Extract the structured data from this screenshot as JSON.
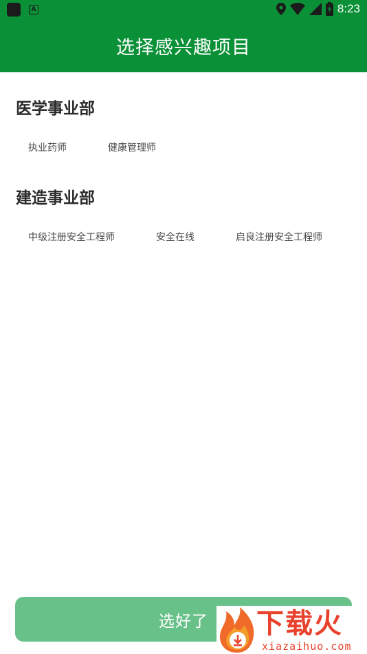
{
  "status_bar": {
    "time": "8:23",
    "icons": [
      "app-icon",
      "a-notification-icon",
      "location-icon",
      "wifi-icon",
      "signal-icon",
      "battery-icon"
    ]
  },
  "header": {
    "title": "选择感兴趣项目"
  },
  "sections": [
    {
      "title": "医学事业部",
      "items": [
        "执业药师",
        "健康管理师"
      ]
    },
    {
      "title": "建造事业部",
      "items": [
        "中级注册安全工程师",
        "安全在线",
        "启良注册安全工程师"
      ]
    }
  ],
  "footer": {
    "confirm_label": "选好了"
  },
  "watermark": {
    "text": "下载火",
    "url": "xiazaihuo.com"
  },
  "colors": {
    "primary": "#0a9036",
    "button": "#69c18a",
    "section_title": "#2b2b2b",
    "tag_text": "#4a4a4a",
    "watermark": "#e8412c"
  }
}
